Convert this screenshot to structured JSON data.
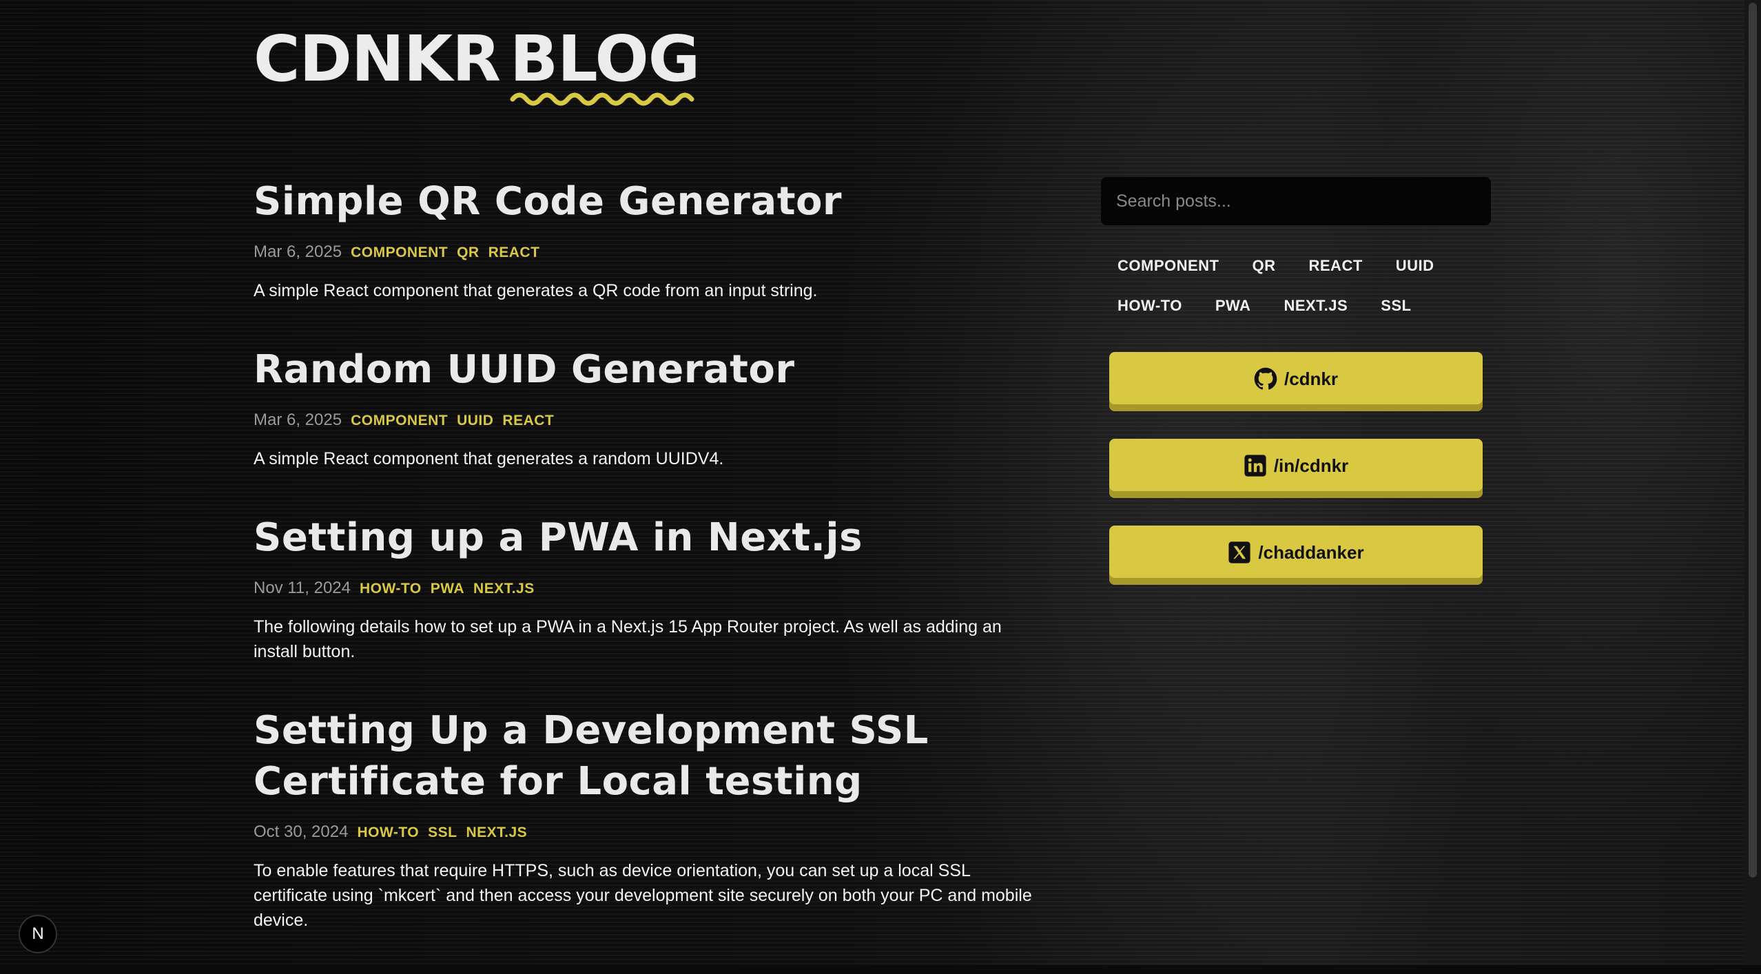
{
  "logo": {
    "part1": "CDNKR",
    "part2": "BLOG"
  },
  "colors": {
    "accent": "#d9c841",
    "background": "#0b0b0b",
    "text": "#ececec",
    "muted": "#9a9a9a"
  },
  "posts": [
    {
      "title": "Simple QR Code Generator",
      "date": "Mar 6, 2025",
      "tags": [
        "COMPONENT",
        "QR",
        "REACT"
      ],
      "excerpt": "A simple React component that generates a QR code from an input string."
    },
    {
      "title": "Random UUID Generator",
      "date": "Mar 6, 2025",
      "tags": [
        "COMPONENT",
        "UUID",
        "REACT"
      ],
      "excerpt": "A simple React component that generates a random UUIDV4."
    },
    {
      "title": "Setting up a PWA in Next.js",
      "date": "Nov 11, 2024",
      "tags": [
        "HOW-TO",
        "PWA",
        "NEXT.JS"
      ],
      "excerpt": "The following details how to set up a PWA in a Next.js 15 App Router project. As well as adding an install button."
    },
    {
      "title": "Setting Up a Development SSL Certificate for Local testing",
      "date": "Oct 30, 2024",
      "tags": [
        "HOW-TO",
        "SSL",
        "NEXT.JS"
      ],
      "excerpt": "To enable features that require HTTPS, such as device orientation, you can set up a local SSL certificate using `mkcert` and then access your development site securely on both your PC and mobile device."
    }
  ],
  "sidebar": {
    "search_placeholder": "Search posts...",
    "tags": [
      "COMPONENT",
      "QR",
      "REACT",
      "UUID",
      "HOW-TO",
      "PWA",
      "NEXT.JS",
      "SSL"
    ],
    "socials": [
      {
        "icon": "github-icon",
        "label": "/cdnkr"
      },
      {
        "icon": "linkedin-icon",
        "label": "/in/cdnkr"
      },
      {
        "icon": "x-icon",
        "label": "/chaddanker"
      }
    ]
  },
  "badge": {
    "letter": "N"
  }
}
